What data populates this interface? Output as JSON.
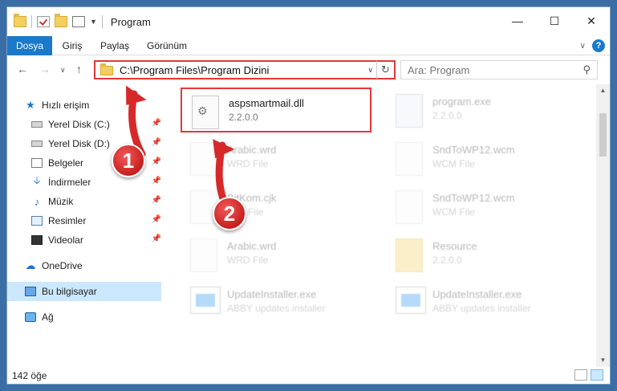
{
  "window": {
    "title": "Program"
  },
  "ribbon": {
    "tabs": [
      {
        "label": "Dosya"
      },
      {
        "label": "Giriş"
      },
      {
        "label": "Paylaş"
      },
      {
        "label": "Görünüm"
      }
    ],
    "help_label": "?"
  },
  "address": {
    "path": "C:\\Program Files\\Program Dizini"
  },
  "search": {
    "placeholder": "Ara: Program"
  },
  "nav": {
    "quick_access": "Hızlı erişim",
    "items": [
      {
        "label": "Yerel Disk (C:)"
      },
      {
        "label": "Yerel Disk (D:)"
      },
      {
        "label": "Belgeler"
      },
      {
        "label": "İndirmeler"
      },
      {
        "label": "Müzik"
      },
      {
        "label": "Resimler"
      },
      {
        "label": "Videolar"
      }
    ],
    "onedrive": "OneDrive",
    "this_pc": "Bu bilgisayar",
    "network": "Ağ"
  },
  "files": [
    {
      "name": "aspsmartmail.dll",
      "sub": "2.2.0.0",
      "icon": "dll-gear-icon"
    },
    {
      "name": "program.exe",
      "sub": "2.2.0.0",
      "icon": "exe-icon"
    },
    {
      "name": "Arabic.wrd",
      "sub": "WRD File",
      "icon": "file-icon"
    },
    {
      "name": "SndToWP12.wcm",
      "sub": "WCM File",
      "icon": "file-icon"
    },
    {
      "name": "BitKom.cjk",
      "sub": "CJK File",
      "icon": "file-icon"
    },
    {
      "name": "SndToWP12.wcm",
      "sub": "WCM File",
      "icon": "file-icon"
    },
    {
      "name": "Arabic.wrd",
      "sub": "WRD File",
      "icon": "file-icon"
    },
    {
      "name": "Resource",
      "sub": "2.2.0.0",
      "icon": "folder-icon"
    },
    {
      "name": "UpdateInstaller.exe",
      "sub": "ABBY updates installer",
      "icon": "installer-icon"
    },
    {
      "name": "UpdateInstaller.exe",
      "sub": "ABBY updates installer",
      "icon": "installer-icon"
    }
  ],
  "status": {
    "item_count": "142 öğe"
  },
  "annotations": {
    "step1": "1",
    "step2": "2",
    "color": "#d62a2a"
  }
}
